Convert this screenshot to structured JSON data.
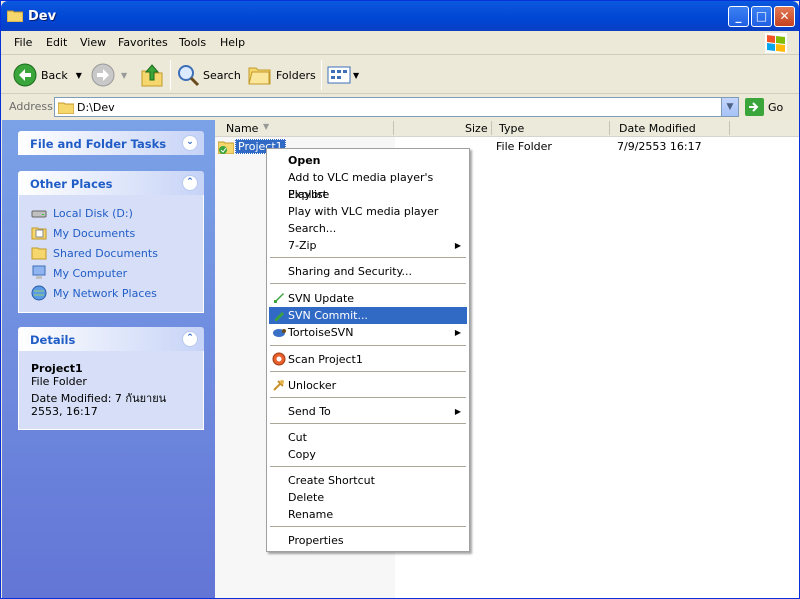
{
  "window": {
    "title": "Dev"
  },
  "menu": [
    "File",
    "Edit",
    "View",
    "Favorites",
    "Tools",
    "Help"
  ],
  "toolbar": {
    "back": "Back",
    "search": "Search",
    "folders": "Folders"
  },
  "address": {
    "label": "Address",
    "value": "D:\\Dev",
    "go": "Go"
  },
  "left": {
    "tasks_title": "File and Folder Tasks",
    "places_title": "Other Places",
    "places": [
      "Local Disk (D:)",
      "My Documents",
      "Shared Documents",
      "My Computer",
      "My Network Places"
    ],
    "details_title": "Details",
    "details_name": "Project1",
    "details_type": "File Folder",
    "details_date": "Date Modified: 7 กันยายน 2553, 16:17"
  },
  "columns": {
    "name": "Name",
    "size": "Size",
    "type": "Type",
    "date": "Date Modified"
  },
  "file": {
    "name": "Project1",
    "type": "File Folder",
    "date": "7/9/2553 16:17"
  },
  "context_menu": {
    "open": "Open",
    "vlc_add": "Add to VLC media player's Playlist",
    "explore": "Explore",
    "vlc_play": "Play with VLC media player",
    "search": "Search...",
    "zip": "7-Zip",
    "sharing": "Sharing and Security...",
    "svn_update": "SVN Update",
    "svn_commit": "SVN Commit...",
    "tortoise": "TortoiseSVN",
    "scan": "Scan Project1",
    "unlocker": "Unlocker",
    "send_to": "Send To",
    "cut": "Cut",
    "copy": "Copy",
    "shortcut": "Create Shortcut",
    "delete": "Delete",
    "rename": "Rename",
    "properties": "Properties"
  }
}
